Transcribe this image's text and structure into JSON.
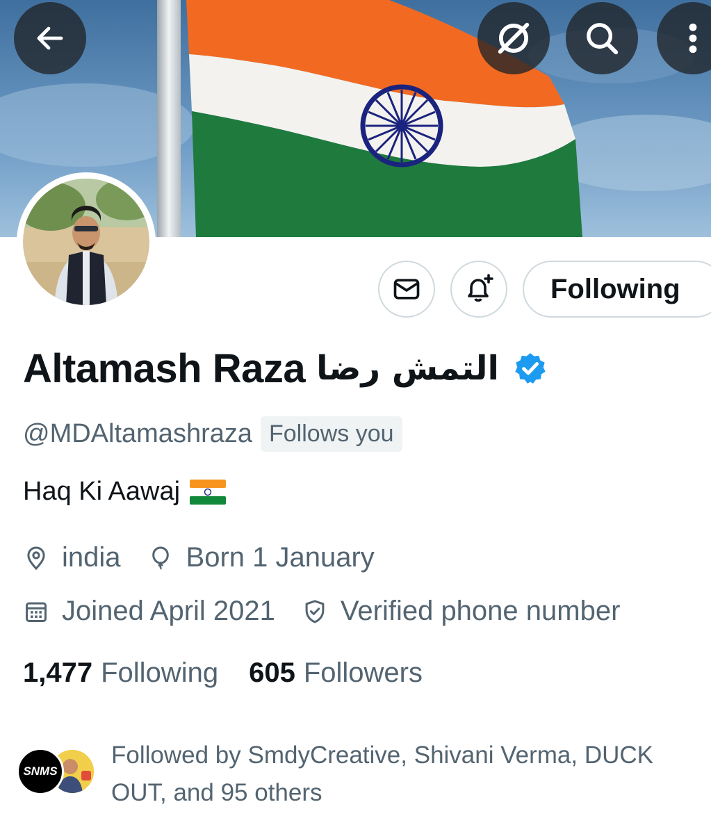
{
  "header": {
    "back_icon": "arrow-left-icon",
    "grok_icon": "grok-icon",
    "search_icon": "search-icon",
    "more_icon": "more-vertical-icon"
  },
  "actions": {
    "message_icon": "mail-icon",
    "notify_icon": "bell-plus-icon",
    "follow_label": "Following"
  },
  "profile": {
    "display_name": "Altamash Raza",
    "arabic_name": "التمش رضا",
    "handle": "@MDAltamashraza",
    "follows_you": "Follows you",
    "bio": "Haq Ki Aawaj",
    "location": "india",
    "birthday": "Born 1 January",
    "joined": "Joined April 2021",
    "verified_phone": "Verified phone number"
  },
  "stats": {
    "following_count": "1,477",
    "following_label": "Following",
    "followers_count": "605",
    "followers_label": "Followers"
  },
  "followed_by": {
    "text": "Followed by SmdyCreative, Shivani Verma, DUCK OUT, and 95 others",
    "avatar1_text": "SNMS"
  },
  "colors": {
    "accent_blue": "#1d9bf0",
    "text_primary": "#0f1419",
    "text_secondary": "#536471",
    "border": "#cfd9de"
  }
}
